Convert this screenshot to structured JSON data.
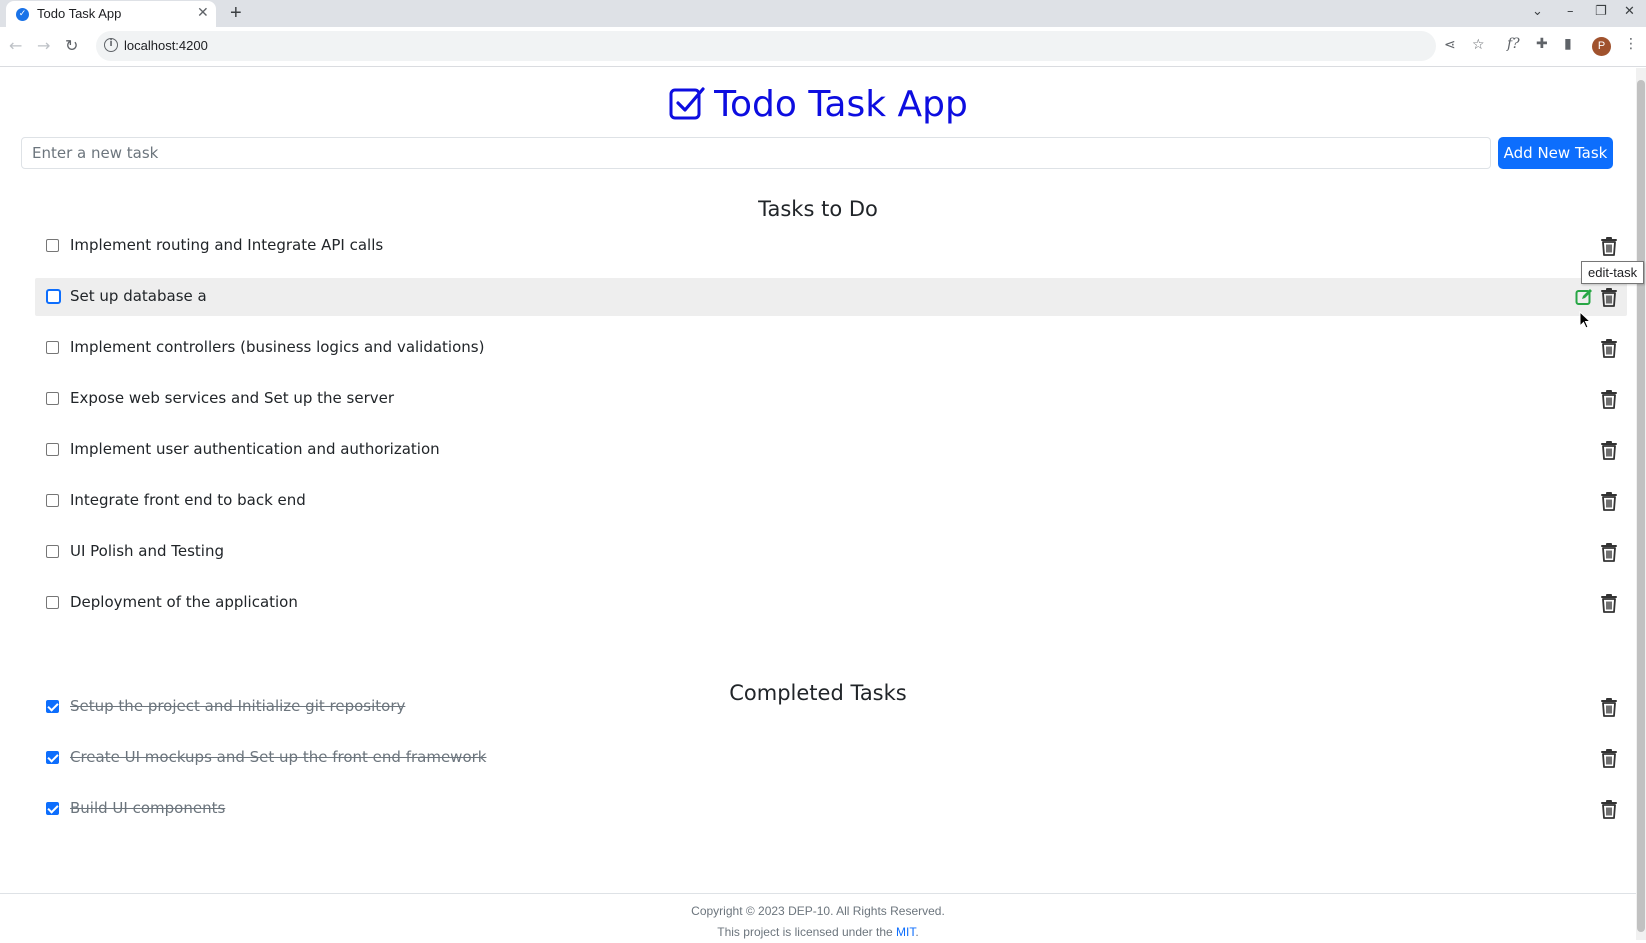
{
  "browser": {
    "tab_title": "Todo Task App",
    "url": "localhost:4200",
    "profile_initial": "P"
  },
  "app": {
    "title": "Todo Task App",
    "input_placeholder": "Enter a new task",
    "add_button": "Add New Task",
    "todo_heading": "Tasks to Do",
    "completed_heading": "Completed Tasks",
    "tooltip": "edit-task",
    "todo_tasks": [
      "Implement routing and Integrate API calls",
      "Set up database a",
      "Implement controllers (business logics and validations)",
      "Expose web services and Set up the server",
      "Implement user authentication and authorization",
      "Integrate front end to back end",
      "UI Polish and Testing",
      "Deployment of the application"
    ],
    "completed_tasks": [
      "Setup the project and Initialize git repository",
      "Create UI mockups and Set up the front end framework",
      "Build UI components"
    ]
  },
  "footer": {
    "copyright": "Copyright © 2023 DEP-10. All Rights Reserved.",
    "license_prefix": "This project is licensed under the",
    "license_link": "MIT",
    "license_suffix": "."
  },
  "colors": {
    "title": "#0d0de0",
    "primary": "#0d6efd",
    "edit_icon": "#28a745"
  }
}
